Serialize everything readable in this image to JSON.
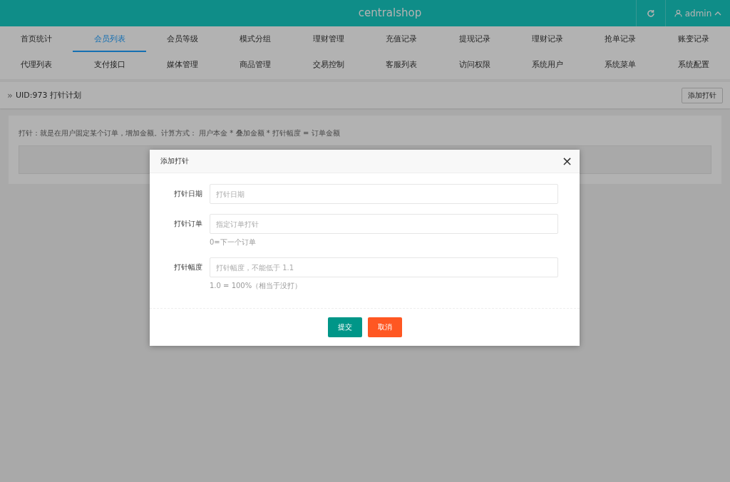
{
  "header": {
    "title": "centralshop",
    "user": "admin"
  },
  "nav": [
    {
      "label": "首页统计",
      "selected": false
    },
    {
      "label": "会员列表",
      "selected": true
    },
    {
      "label": "会员等级",
      "selected": false
    },
    {
      "label": "模式分组",
      "selected": false
    },
    {
      "label": "理财管理",
      "selected": false
    },
    {
      "label": "充值记录",
      "selected": false
    },
    {
      "label": "提现记录",
      "selected": false
    },
    {
      "label": "理财记录",
      "selected": false
    },
    {
      "label": "抢单记录",
      "selected": false
    },
    {
      "label": "账变记录",
      "selected": false
    },
    {
      "label": "代理列表",
      "selected": false
    },
    {
      "label": "支付接口",
      "selected": false
    },
    {
      "label": "媒体管理",
      "selected": false
    },
    {
      "label": "商品管理",
      "selected": false
    },
    {
      "label": "交易控制",
      "selected": false
    },
    {
      "label": "客服列表",
      "selected": false
    },
    {
      "label": "访问权限",
      "selected": false
    },
    {
      "label": "系统用户",
      "selected": false
    },
    {
      "label": "系统菜单",
      "selected": false
    },
    {
      "label": "系统配置",
      "selected": false
    }
  ],
  "breadcrumb": {
    "separator": "»",
    "title": "UID:973 打针计划",
    "button": "添加打针"
  },
  "card": {
    "note": "打针：就是在用户固定某个订单，增加金额。计算方式： 用户本金 * 叠加金额 * 打针幅度 = 订单金额"
  },
  "modal": {
    "title": "添加打针",
    "close": "×",
    "fields": [
      {
        "label": "打针日期",
        "placeholder": "打针日期"
      },
      {
        "label": "打针订单",
        "placeholder": "指定订单打针",
        "hint": "0=下一个订单"
      },
      {
        "label": "打针幅度",
        "placeholder": "打针幅度，不能低于 1.1",
        "hint": "1.0 = 100%（相当于没打）"
      }
    ],
    "buttons": [
      {
        "label": "提交",
        "kind": "primary"
      },
      {
        "label": "取消",
        "kind": "danger"
      }
    ]
  }
}
